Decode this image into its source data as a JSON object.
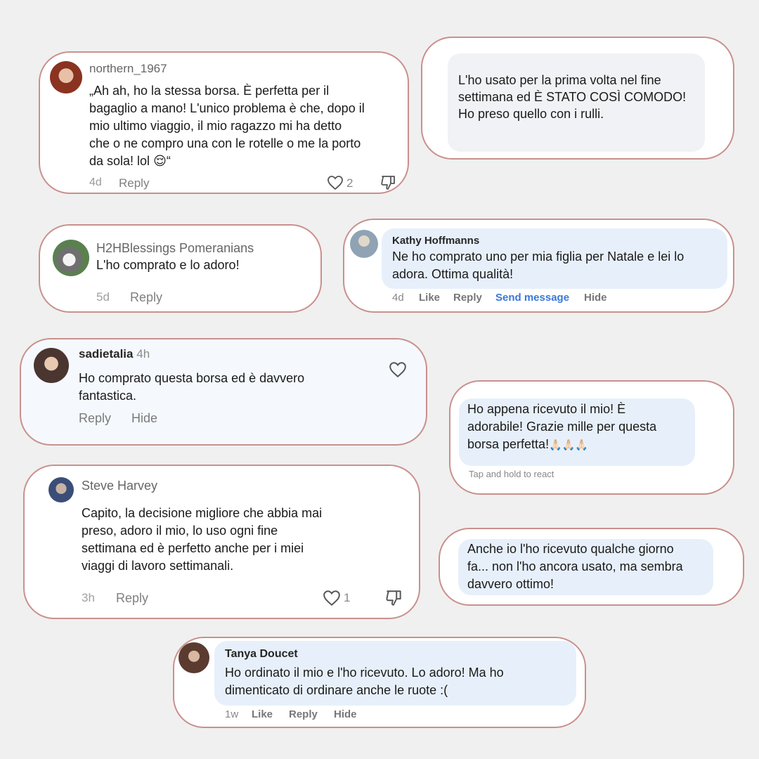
{
  "comments": [
    {
      "user": "northern_1967",
      "text_lines": [
        "„Ah ah, ho la stessa borsa. È perfetta per il",
        "bagaglio a mano! L'unico problema è che, dopo il",
        "mio ultimo viaggio, il mio ragazzo mi ha detto",
        "che o ne compro una con le rotelle o me la porto"
      ],
      "last_line_text": "da sola! lol",
      "last_line_emoji": "😌",
      "last_line_quote": "“",
      "time": "4d",
      "reply": "Reply",
      "likes": "2"
    },
    {
      "text_lines": [
        "L'ho usato per la prima volta nel fine",
        "settimana ed È STATO COSÌ COMODO!",
        "Ho preso quello con i rulli."
      ]
    },
    {
      "user": "H2HBlessings Pomeranians",
      "text": "L'ho comprato e lo adoro!",
      "time": "5d",
      "reply": "Reply"
    },
    {
      "user": "Kathy Hoffmanns",
      "text_lines": [
        "Ne ho comprato uno per mia figlia per Natale e lei lo",
        "adora. Ottima qualità!"
      ],
      "time": "4d",
      "like": "Like",
      "reply": "Reply",
      "send": "Send message",
      "hide": "Hide"
    },
    {
      "user": "sadietalia",
      "time_inline": "4h",
      "text_lines": [
        "Ho comprato questa borsa ed è davvero",
        "fantastica."
      ],
      "reply": "Reply",
      "hide": "Hide"
    },
    {
      "text_lines": [
        "Ho appena ricevuto il mio! È",
        "adorabile! Grazie mille per questa"
      ],
      "last_line_text": "borsa perfetta!",
      "last_line_emoji": "🙏🏻🙏🏻🙏🏻",
      "hint": "Tap and hold to react"
    },
    {
      "user": "Steve Harvey",
      "text_lines": [
        "Capito, la decisione migliore che abbia mai",
        "preso, adoro il mio, lo uso ogni fine",
        "settimana ed è perfetto anche per i miei",
        "viaggi di lavoro settimanali."
      ],
      "time": "3h",
      "reply": "Reply",
      "likes": "1"
    },
    {
      "text_lines": [
        "Anche io l'ho ricevuto qualche giorno",
        "fa... non l'ho ancora usato, ma sembra",
        "davvero ottimo!"
      ]
    },
    {
      "user": "Tanya Doucet",
      "text_lines": [
        "Ho ordinato il mio e l'ho ricevuto. Lo adoro! Ma ho",
        "dimenticato di ordinare anche le ruote :("
      ],
      "time": "1w",
      "like": "Like",
      "reply": "Reply",
      "hide": "Hide"
    }
  ],
  "colors": {
    "background": "#f0f0f0",
    "card_border": "#c9908d",
    "bubble_gray": "#f0f2f5",
    "bubble_blue": "#e7f0fa",
    "link_blue": "#3a78d8"
  },
  "icons": [
    "heart-icon",
    "dislike-icon"
  ]
}
